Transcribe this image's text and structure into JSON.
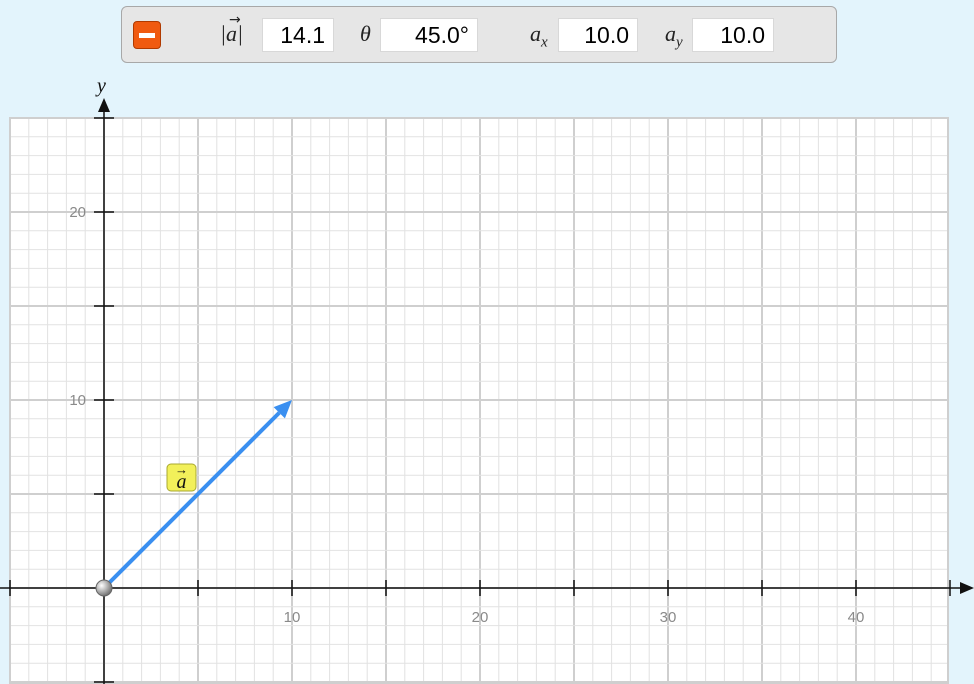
{
  "toolbar": {
    "remove_icon": "minus-icon",
    "magnitude_label": "|a|",
    "magnitude_value": "14.1",
    "angle_label": "θ",
    "angle_value": "45.0°",
    "ax_label": "a",
    "ax_sub": "x",
    "ax_value": "10.0",
    "ay_label": "a",
    "ay_sub": "y",
    "ay_value": "10.0"
  },
  "graph": {
    "y_axis_label": "y",
    "x_ticks": [
      "10",
      "20",
      "30",
      "40"
    ],
    "y_ticks": [
      "10",
      "20"
    ],
    "xlim": [
      -5,
      45
    ],
    "ylim": [
      -5,
      25
    ],
    "vector": {
      "label": "a",
      "start": [
        0,
        0
      ],
      "end": [
        10,
        10
      ],
      "color": "#3a8ff0"
    },
    "label_bg": "#f2f05a"
  }
}
